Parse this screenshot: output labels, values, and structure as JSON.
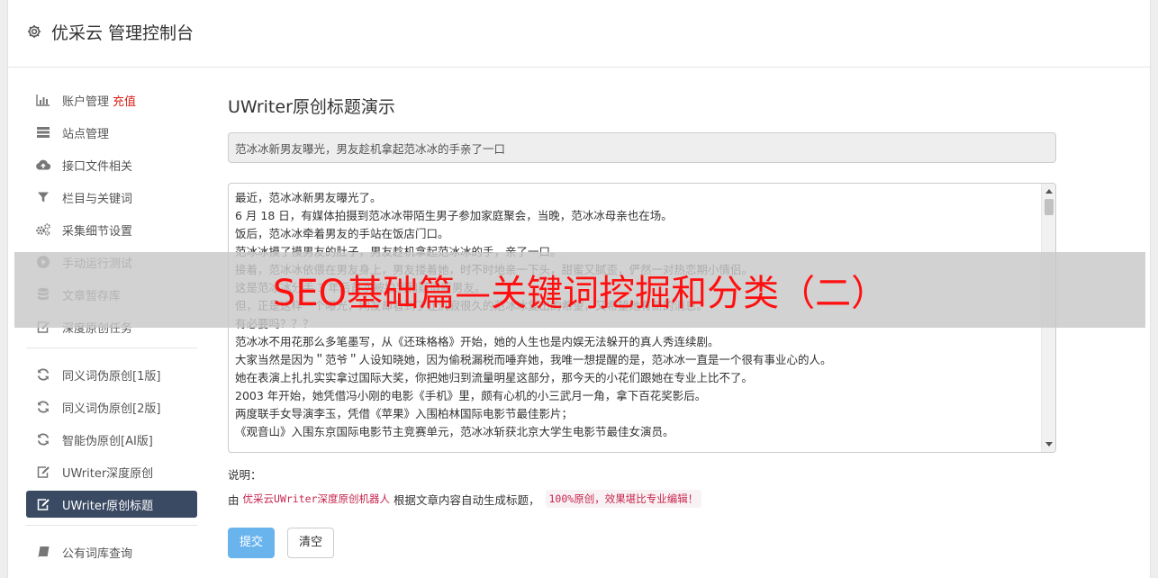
{
  "app": {
    "title": "优采云 管理控制台"
  },
  "sidebar": {
    "group1": [
      {
        "label": "账户管理",
        "icon": "bar-chart-icon",
        "badge": "充值"
      },
      {
        "label": "站点管理",
        "icon": "server-icon"
      },
      {
        "label": "接口文件相关",
        "icon": "cloud-upload-icon"
      },
      {
        "label": "栏目与关键词",
        "icon": "filter-icon"
      },
      {
        "label": "采集细节设置",
        "icon": "cogs-icon"
      },
      {
        "label": "手动运行测试",
        "icon": "play-circle-icon"
      },
      {
        "label": "文章暂存库",
        "icon": "database-icon"
      },
      {
        "label": "深度原创任务",
        "icon": "edit-icon"
      }
    ],
    "group2": [
      {
        "label": "同义词伪原创[1版]",
        "icon": "refresh-icon"
      },
      {
        "label": "同义词伪原创[2版]",
        "icon": "refresh-icon"
      },
      {
        "label": "智能伪原创[AI版]",
        "icon": "refresh-icon"
      },
      {
        "label": "UWriter深度原创",
        "icon": "edit-icon"
      },
      {
        "label": "UWriter原创标题",
        "icon": "edit-icon",
        "active": true
      }
    ],
    "group3": [
      {
        "label": "公有词库查询",
        "icon": "book-icon"
      }
    ]
  },
  "main": {
    "heading": "UWriter原创标题演示",
    "title_value": "范冰冰新男友曝光，男友趁机拿起范冰冰的手亲了一口",
    "article_lines": [
      "最近，范冰冰新男友曝光了。",
      "6 月 18 日，有媒体拍摄到范冰冰带陌生男子参加家庭聚会，当晚，范冰冰母亲也在场。",
      "饭后，范冰冰牵着男友的手站在饭店门口。",
      "范冰冰摸了摸男友的肚子，男友趁机拿起范冰冰的手，亲了一口。",
      "接着，范冰冰依偎在男友身上，男友搂着她，时不时地亲一下头，甜蜜又腻歪，俨然一对热恋期小情侣。",
      "这是范冰冰分手 3 年后首次被拍到和疑似新男友。",
      "但，正是这样一个曝光，网友却看到了让沉寂很久的范冰冰复出的希望，又希望她有新的消息。",
      "有必要吗？？？",
      "范冰冰不用花那么多笔墨写，从《还珠格格》开始，她的人生也是内娱无法躲开的真人秀连续剧。",
      "大家当然是因为＂范爷＂人设知晓她，因为偷税漏税而唾弃她，我唯一想提醒的是，范冰冰一直是一个很有事业心的人。",
      "她在表演上扎扎实实拿过国际大奖，你把她归到流量明星这部分，那今天的小花们跟她在专业上比不了。",
      "2003 年开始，她凭借冯小刚的电影《手机》里，颇有心机的小三武月一角，拿下百花奖影后。",
      "两度联手女导演李玉，凭借《苹果》入围柏林国际电影节最佳影片；",
      "《观音山》入围东京国际电影节主竞赛单元，范冰冰斩获北京大学生电影节最佳女演员。"
    ],
    "note_label": "说明：",
    "note_prefix": "由",
    "note_code1": "优采云UWriter深度原创机器人",
    "note_mid": "根据文章内容自动生成标题，",
    "note_code2": "100%原创，效果堪比专业编辑！",
    "submit_label": "提交",
    "clear_label": "清空"
  },
  "overlay": {
    "text": "SEO基础篇—关键词挖掘和分类（二）"
  },
  "colors": {
    "active_nav": "#3a4a63",
    "primary_button": "#6ab4ee",
    "overlay_text": "#ff1010",
    "recharge": "#d9221a"
  }
}
